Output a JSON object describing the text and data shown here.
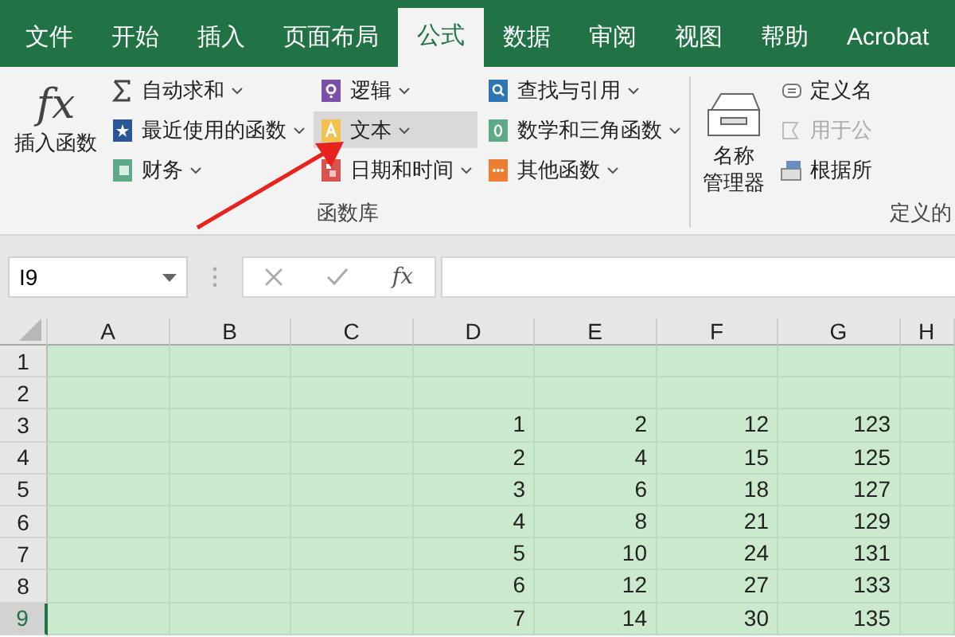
{
  "tabs": [
    {
      "label": "文件",
      "selected": false
    },
    {
      "label": "开始",
      "selected": false
    },
    {
      "label": "插入",
      "selected": false
    },
    {
      "label": "页面布局",
      "selected": false
    },
    {
      "label": "公式",
      "selected": true
    },
    {
      "label": "数据",
      "selected": false
    },
    {
      "label": "审阅",
      "selected": false
    },
    {
      "label": "视图",
      "selected": false
    },
    {
      "label": "帮助",
      "selected": false
    },
    {
      "label": "Acrobat",
      "selected": false
    }
  ],
  "ribbon": {
    "function_library": {
      "insert_function": {
        "symbol": "fx",
        "label": "插入函数"
      },
      "columns": [
        [
          {
            "label": "自动求和",
            "highlighted": false
          },
          {
            "label": "最近使用的函数",
            "highlighted": false
          },
          {
            "label": "财务",
            "highlighted": false
          }
        ],
        [
          {
            "label": "逻辑",
            "highlighted": false
          },
          {
            "label": "文本",
            "highlighted": true
          },
          {
            "label": "日期和时间",
            "highlighted": false
          }
        ],
        [
          {
            "label": "查找与引用",
            "highlighted": false
          },
          {
            "label": "数学和三角函数",
            "highlighted": false
          },
          {
            "label": "其他函数",
            "highlighted": false
          }
        ]
      ],
      "group_label": "函数库"
    },
    "defined_names": {
      "name_manager": {
        "label_lines": [
          "名称",
          "管理器"
        ]
      },
      "items": [
        {
          "label": "定义名",
          "disabled": false
        },
        {
          "label": "用于公",
          "disabled": true
        },
        {
          "label": "根据所",
          "disabled": false
        }
      ],
      "group_label": "定义的"
    }
  },
  "formula_bar": {
    "name_box": "I9",
    "function_symbol": "fx"
  },
  "sheet": {
    "columns": [
      "A",
      "B",
      "C",
      "D",
      "E",
      "F",
      "G",
      "H"
    ],
    "rows": [
      {
        "header": "1",
        "selected": false
      },
      {
        "header": "2",
        "selected": false
      },
      {
        "header": "3",
        "selected": false,
        "cells": [
          null,
          null,
          null,
          "1",
          "2",
          "12",
          "123",
          null
        ]
      },
      {
        "header": "4",
        "selected": false,
        "cells": [
          null,
          null,
          null,
          "2",
          "4",
          "15",
          "125",
          null
        ]
      },
      {
        "header": "5",
        "selected": false,
        "cells": [
          null,
          null,
          null,
          "3",
          "6",
          "18",
          "127",
          null
        ]
      },
      {
        "header": "6",
        "selected": false,
        "cells": [
          null,
          null,
          null,
          "4",
          "8",
          "21",
          "129",
          null
        ]
      },
      {
        "header": "7",
        "selected": false,
        "cells": [
          null,
          null,
          null,
          "5",
          "10",
          "24",
          "131",
          null
        ]
      },
      {
        "header": "8",
        "selected": false,
        "cells": [
          null,
          null,
          null,
          "6",
          "12",
          "27",
          "133",
          null
        ]
      },
      {
        "header": "9",
        "selected": true,
        "cells": [
          null,
          null,
          null,
          "7",
          "14",
          "30",
          "135",
          null
        ]
      }
    ]
  }
}
